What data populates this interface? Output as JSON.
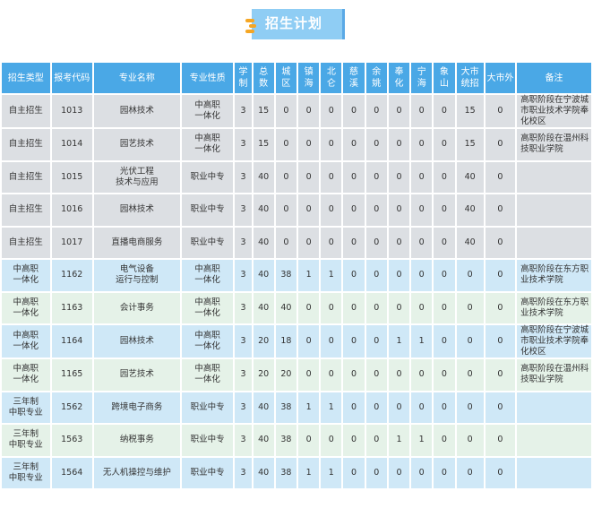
{
  "title": "招生计划",
  "headers": [
    "招生类型",
    "报考代码",
    "专业名称",
    "专业性质",
    "学制",
    "总数",
    "城区",
    "镇海",
    "北仑",
    "慈溪",
    "余姚",
    "奉化",
    "宁海",
    "象山",
    "大市统招",
    "大市外",
    "备注"
  ],
  "rows": [
    {
      "type": "自主招生",
      "code": "1013",
      "major": "园林技术",
      "nature": "中高职一体化",
      "years": "3",
      "total": "15",
      "chengqu": "0",
      "zhenhai": "0",
      "beilun": "0",
      "cixi": "0",
      "yuyao": "0",
      "fenghua": "0",
      "ninghai": "0",
      "xiangshan": "0",
      "dashi": "15",
      "dashiwai": "0",
      "note": "高职阶段在宁波城市职业技术学院奉化校区",
      "style": "zizhu"
    },
    {
      "type": "自主招生",
      "code": "1014",
      "major": "园艺技术",
      "nature": "中高职一体化",
      "years": "3",
      "total": "15",
      "chengqu": "0",
      "zhenhai": "0",
      "beilun": "0",
      "cixi": "0",
      "yuyao": "0",
      "fenghua": "0",
      "ninghai": "0",
      "xiangshan": "0",
      "dashi": "15",
      "dashiwai": "0",
      "note": "高职阶段在温州科技职业学院",
      "style": "zizhu"
    },
    {
      "type": "自主招生",
      "code": "1015",
      "major": "光伏工程技术与应用",
      "nature": "职业中专",
      "years": "3",
      "total": "40",
      "chengqu": "0",
      "zhenhai": "0",
      "beilun": "0",
      "cixi": "0",
      "yuyao": "0",
      "fenghua": "0",
      "ninghai": "0",
      "xiangshan": "0",
      "dashi": "40",
      "dashiwai": "0",
      "note": "",
      "style": "zizhu"
    },
    {
      "type": "自主招生",
      "code": "1016",
      "major": "园林技术",
      "nature": "职业中专",
      "years": "3",
      "total": "40",
      "chengqu": "0",
      "zhenhai": "0",
      "beilun": "0",
      "cixi": "0",
      "yuyao": "0",
      "fenghua": "0",
      "ninghai": "0",
      "xiangshan": "0",
      "dashi": "40",
      "dashiwai": "0",
      "note": "",
      "style": "zizhu"
    },
    {
      "type": "自主招生",
      "code": "1017",
      "major": "直播电商服务",
      "nature": "职业中专",
      "years": "3",
      "total": "40",
      "chengqu": "0",
      "zhenhai": "0",
      "beilun": "0",
      "cixi": "0",
      "yuyao": "0",
      "fenghua": "0",
      "ninghai": "0",
      "xiangshan": "0",
      "dashi": "40",
      "dashiwai": "0",
      "note": "",
      "style": "zizhu"
    },
    {
      "type": "中高职一体化",
      "code": "1162",
      "major": "电气设备运行与控制",
      "nature": "中高职一体化",
      "years": "3",
      "total": "40",
      "chengqu": "38",
      "zhenhai": "1",
      "beilun": "1",
      "cixi": "0",
      "yuyao": "0",
      "fenghua": "0",
      "ninghai": "0",
      "xiangshan": "0",
      "dashi": "0",
      "dashiwai": "0",
      "note": "高职阶段在东方职业技术学院",
      "style": "blue"
    },
    {
      "type": "中高职一体化",
      "code": "1163",
      "major": "会计事务",
      "nature": "中高职一体化",
      "years": "3",
      "total": "40",
      "chengqu": "40",
      "zhenhai": "0",
      "beilun": "0",
      "cixi": "0",
      "yuyao": "0",
      "fenghua": "0",
      "ninghai": "0",
      "xiangshan": "0",
      "dashi": "0",
      "dashiwai": "0",
      "note": "高职阶段在东方职业技术学院",
      "style": "green"
    },
    {
      "type": "中高职一体化",
      "code": "1164",
      "major": "园林技术",
      "nature": "中高职一体化",
      "years": "3",
      "total": "20",
      "chengqu": "18",
      "zhenhai": "0",
      "beilun": "0",
      "cixi": "0",
      "yuyao": "0",
      "fenghua": "1",
      "ninghai": "1",
      "xiangshan": "0",
      "dashi": "0",
      "dashiwai": "0",
      "note": "高职阶段在宁波城市职业技术学院奉化校区",
      "style": "blue"
    },
    {
      "type": "中高职一体化",
      "code": "1165",
      "major": "园艺技术",
      "nature": "中高职一体化",
      "years": "3",
      "total": "20",
      "chengqu": "20",
      "zhenhai": "0",
      "beilun": "0",
      "cixi": "0",
      "yuyao": "0",
      "fenghua": "0",
      "ninghai": "0",
      "xiangshan": "0",
      "dashi": "0",
      "dashiwai": "0",
      "note": "高职阶段在温州科技职业学院",
      "style": "green"
    },
    {
      "type": "三年制中职专业",
      "code": "1562",
      "major": "跨境电子商务",
      "nature": "职业中专",
      "years": "3",
      "total": "40",
      "chengqu": "38",
      "zhenhai": "1",
      "beilun": "1",
      "cixi": "0",
      "yuyao": "0",
      "fenghua": "0",
      "ninghai": "0",
      "xiangshan": "0",
      "dashi": "0",
      "dashiwai": "0",
      "note": "",
      "style": "blue"
    },
    {
      "type": "三年制中职专业",
      "code": "1563",
      "major": "纳税事务",
      "nature": "职业中专",
      "years": "3",
      "total": "40",
      "chengqu": "38",
      "zhenhai": "0",
      "beilun": "0",
      "cixi": "0",
      "yuyao": "0",
      "fenghua": "1",
      "ninghai": "1",
      "xiangshan": "0",
      "dashi": "0",
      "dashiwai": "0",
      "note": "",
      "style": "green"
    },
    {
      "type": "三年制中职专业",
      "code": "1564",
      "major": "无人机操控与维护",
      "nature": "职业中专",
      "years": "3",
      "total": "40",
      "chengqu": "38",
      "zhenhai": "1",
      "beilun": "1",
      "cixi": "0",
      "yuyao": "0",
      "fenghua": "0",
      "ninghai": "0",
      "xiangshan": "0",
      "dashi": "0",
      "dashiwai": "0",
      "note": "",
      "style": "blue"
    }
  ],
  "colors": {
    "header": "#4aa8e6",
    "zizhu": "#dcdfe3",
    "blue": "#cfe8f7",
    "green": "#e5f2e8",
    "title_bg": "#8fcdf4",
    "accent": "#f5a623"
  }
}
